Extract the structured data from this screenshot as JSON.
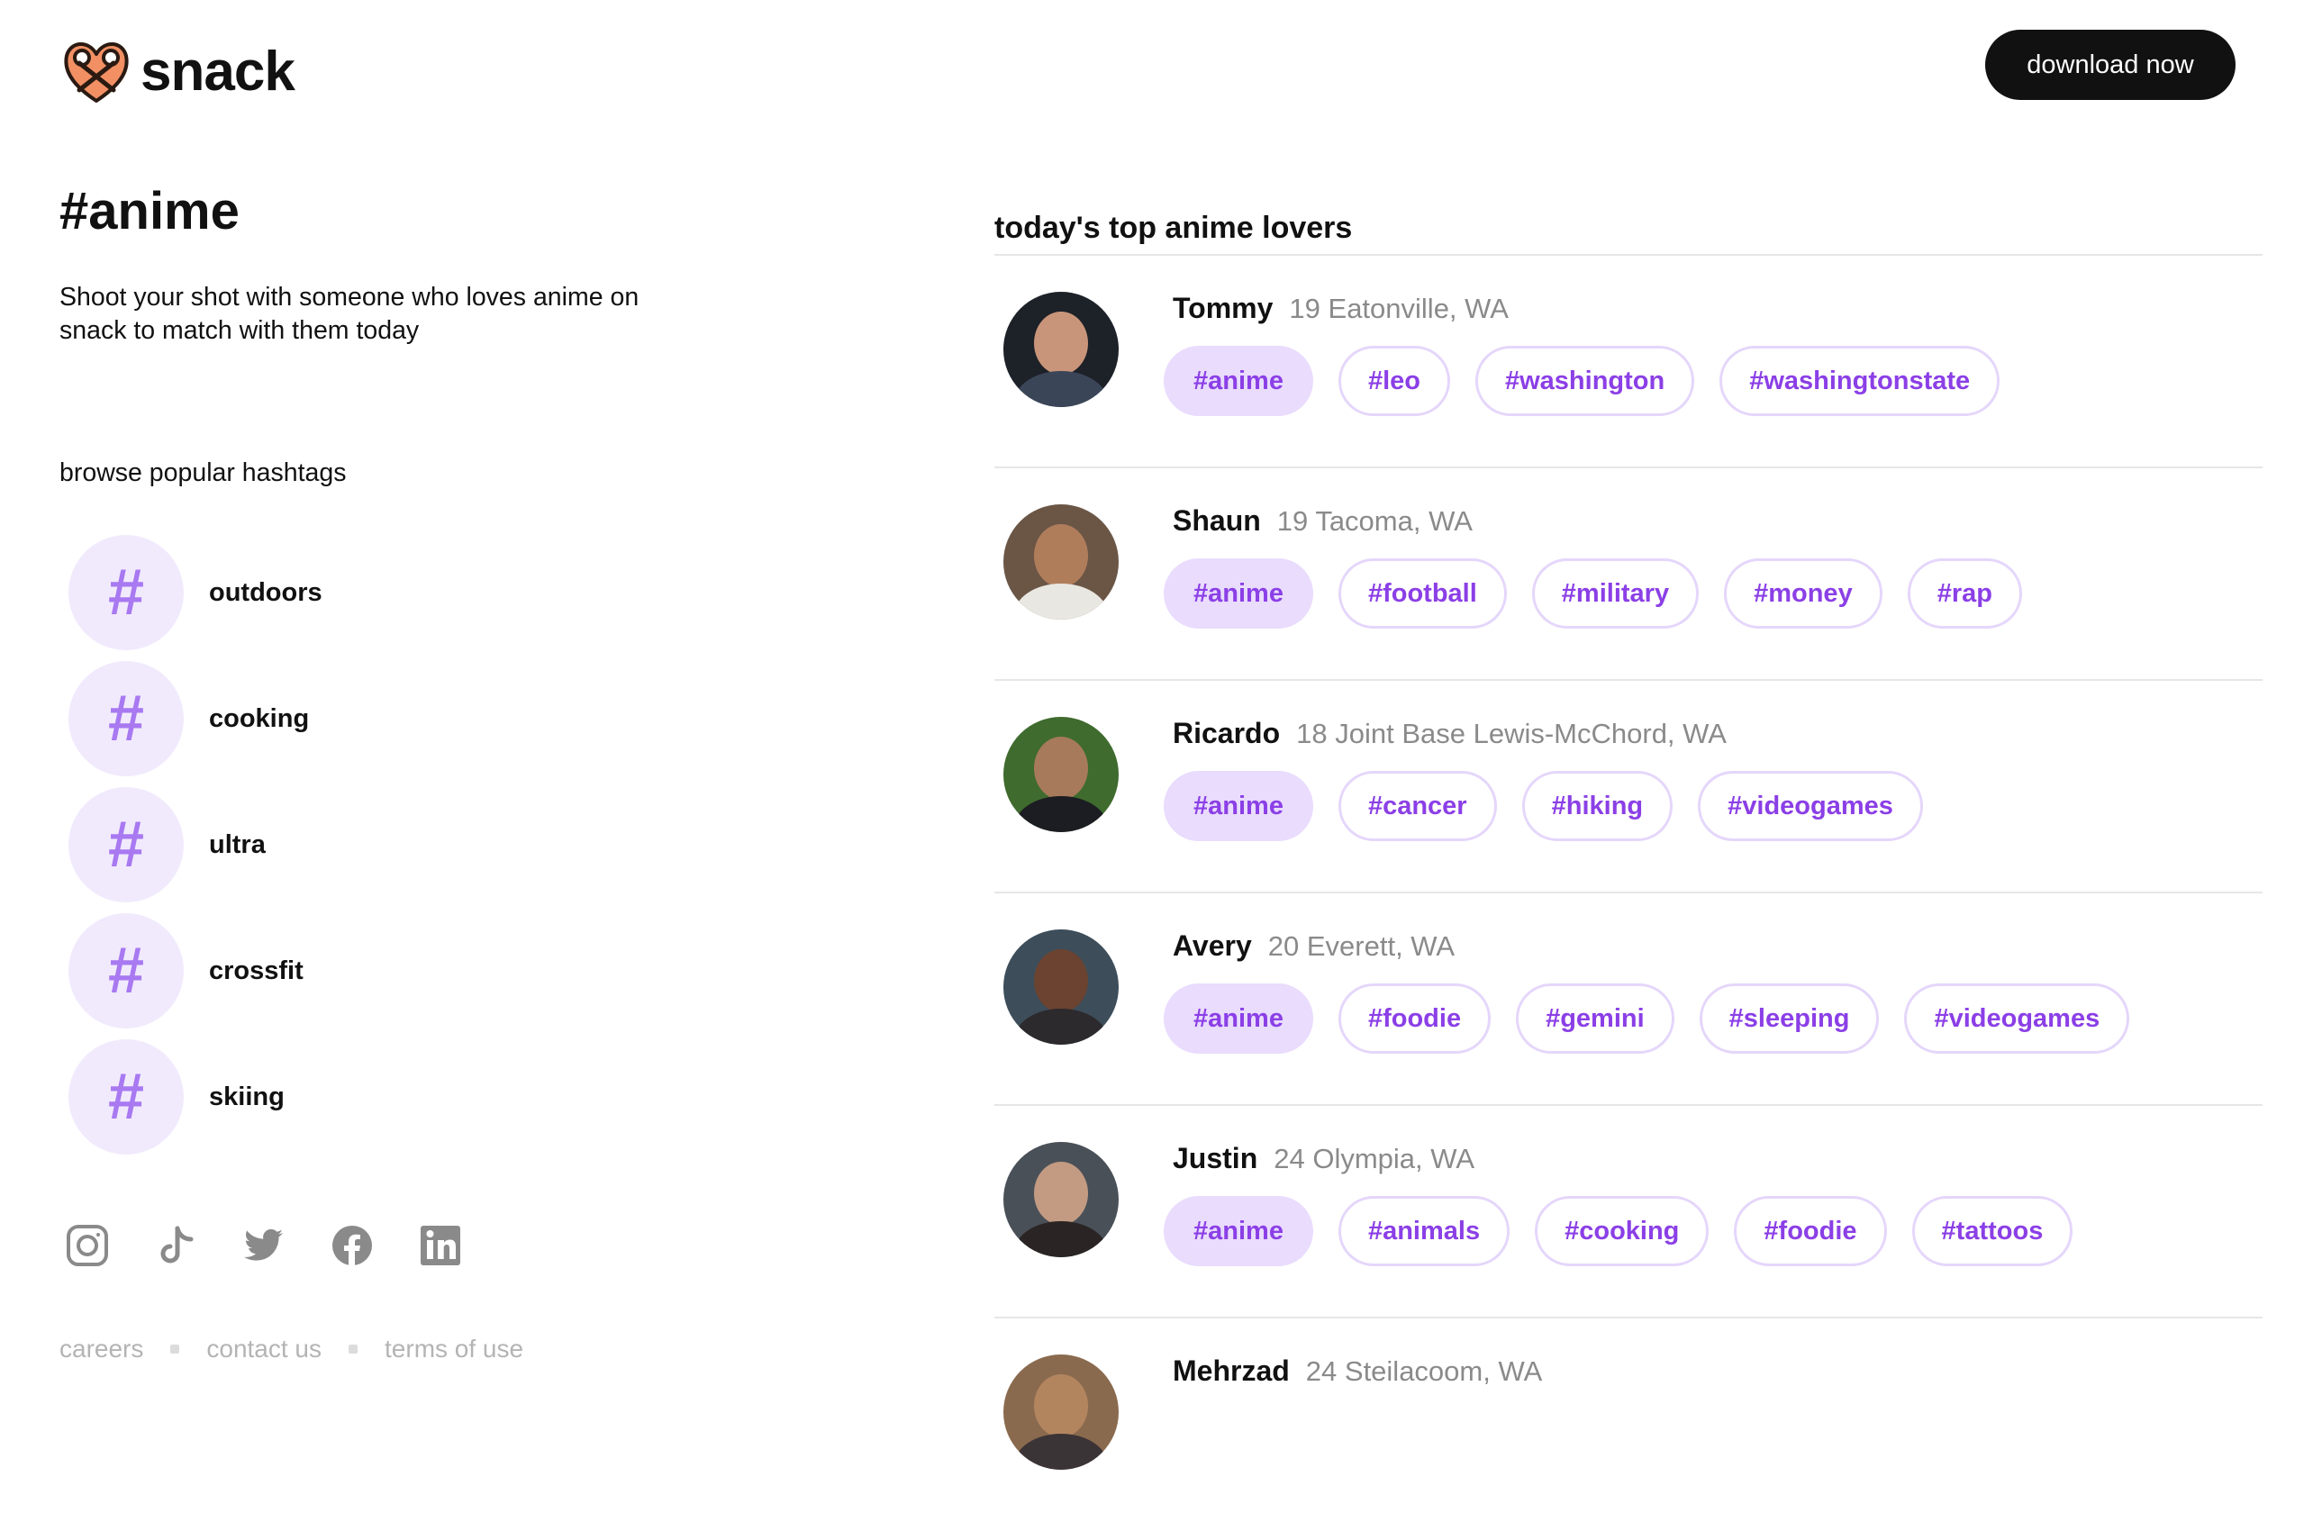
{
  "header": {
    "logo_text": "snack",
    "download_label": "download now"
  },
  "hashtag_page": {
    "title": "#anime",
    "intro": "Shoot your shot with someone who loves anime on snack to match with them today",
    "browse_heading": "browse popular hashtags",
    "popular": [
      {
        "symbol": "#",
        "label": "outdoors"
      },
      {
        "symbol": "#",
        "label": "cooking"
      },
      {
        "symbol": "#",
        "label": "ultra"
      },
      {
        "symbol": "#",
        "label": "crossfit"
      },
      {
        "symbol": "#",
        "label": "skiing"
      }
    ]
  },
  "social": {
    "icons": [
      "instagram-icon",
      "tiktok-icon",
      "twitter-icon",
      "facebook-icon",
      "linkedin-icon"
    ],
    "color": "#8a8a8a"
  },
  "footer": {
    "links": [
      "careers",
      "contact us",
      "terms of use"
    ]
  },
  "top_lovers": {
    "heading": "today's top anime lovers",
    "users": [
      {
        "name": "Tommy",
        "meta": "19 Eatonville, WA",
        "tags": [
          "#anime",
          "#leo",
          "#washington",
          "#washingtonstate"
        ]
      },
      {
        "name": "Shaun",
        "meta": "19 Tacoma, WA",
        "tags": [
          "#anime",
          "#football",
          "#military",
          "#money",
          "#rap"
        ]
      },
      {
        "name": "Ricardo",
        "meta": "18 Joint Base Lewis-McChord, WA",
        "tags": [
          "#anime",
          "#cancer",
          "#hiking",
          "#videogames"
        ]
      },
      {
        "name": "Avery",
        "meta": "20 Everett, WA",
        "tags": [
          "#anime",
          "#foodie",
          "#gemini",
          "#sleeping",
          "#videogames"
        ]
      },
      {
        "name": "Justin",
        "meta": "24 Olympia, WA",
        "tags": [
          "#anime",
          "#animals",
          "#cooking",
          "#foodie",
          "#tattoos"
        ]
      },
      {
        "name": "Mehrzad",
        "meta": "24 Steilacoom, WA",
        "tags": []
      }
    ]
  },
  "colors": {
    "brand_dark": "#111111",
    "accent_purple": "#8b3fe6",
    "tag_active_bg": "#e9dcfd",
    "hash_circle_bg": "#f1eafd",
    "logo_orange": "#f29064"
  }
}
